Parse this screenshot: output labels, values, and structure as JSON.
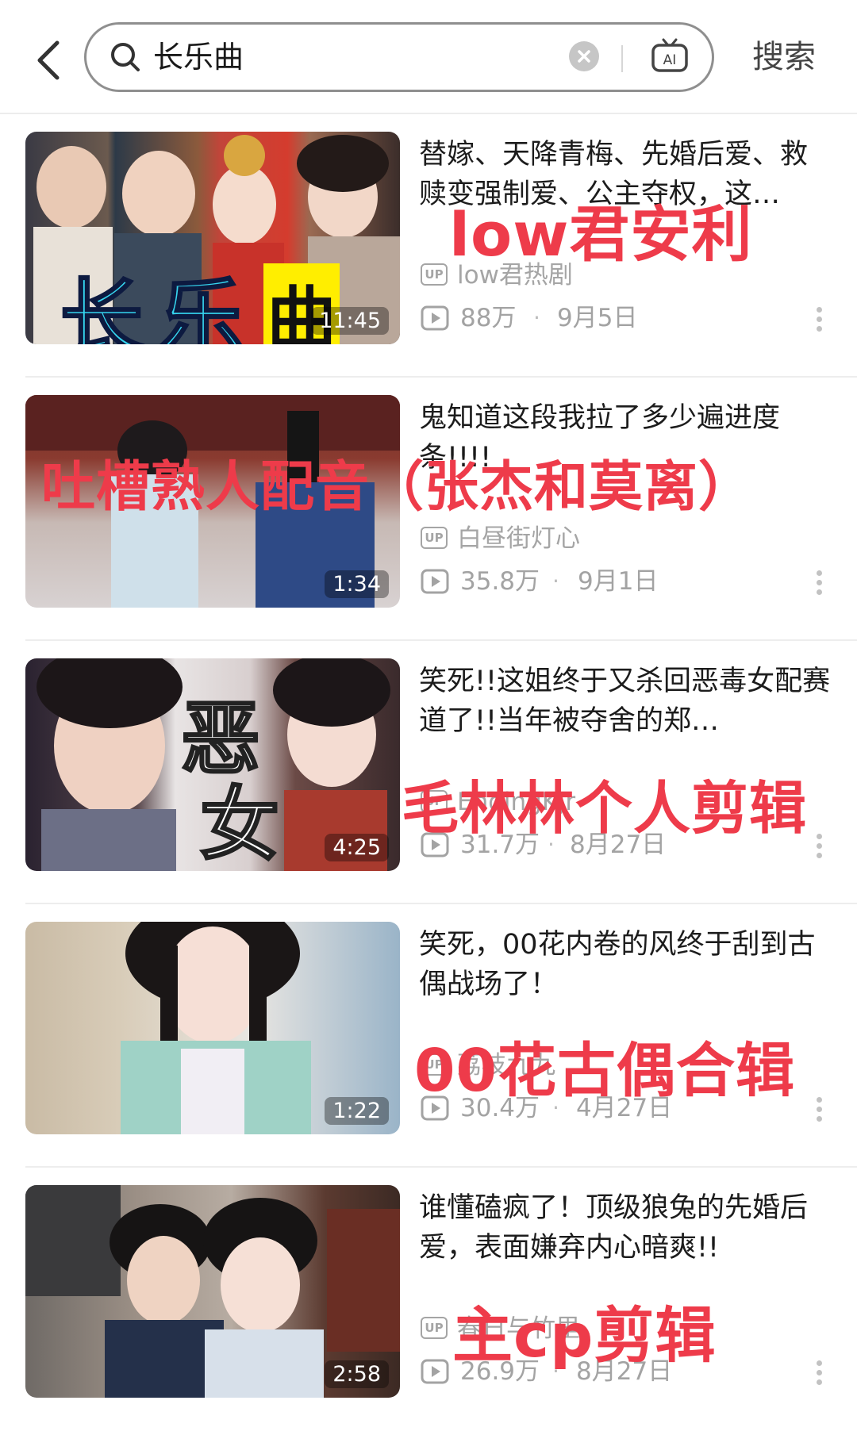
{
  "search": {
    "query": "长乐曲",
    "submit_label": "搜索",
    "ai_label": "AI"
  },
  "results": [
    {
      "title": "替嫁、天降青梅、先婚后爱、救赎变强制爱、公主夺权，这…",
      "uploader": "low君热剧",
      "views": "88万",
      "date": "9月5日",
      "duration": "11:45",
      "overlay_text": "low君安利",
      "thumb_text": [
        "长",
        "乐",
        "曲"
      ]
    },
    {
      "title": "鬼知道这段我拉了多少遍进度条!!!!",
      "uploader": "白昼街灯心",
      "views": "35.8万",
      "date": "9月1日",
      "duration": "1:34",
      "overlay_text": "吐槽熟人配音（张杰和莫离）"
    },
    {
      "title": "笑死!!这姐终于又杀回恶毒女配赛道了!!当年被夺舍的郑…",
      "uploader": "EndingKJr",
      "views": "31.7万",
      "date": "8月27日",
      "duration": "4:25",
      "overlay_text": "毛林林个人剪辑",
      "thumb_text": [
        "恶",
        "女"
      ]
    },
    {
      "title": "笑死，00花内卷的风终于刮到古偶战场了！",
      "uploader": "荔枝九九",
      "views": "30.4万",
      "date": "4月27日",
      "duration": "1:22",
      "overlay_text": "00花古偶合辑"
    },
    {
      "title": "谁懂磕疯了！顶级狼兔的先婚后爱，表面嫌弃内心暗爽!!",
      "uploader": "春日与竹里",
      "views": "26.9万",
      "date": "8月27日",
      "duration": "2:58",
      "overlay_text": "主cp剪辑"
    }
  ],
  "icons": {
    "back": "chevron-left-icon",
    "search": "search-icon",
    "clear": "clear-icon",
    "ai": "ai-tv-icon",
    "play": "play-count-icon",
    "more": "more-vertical-icon"
  },
  "colors": {
    "overlay_red": "#ee3b4a",
    "meta_gray": "#a3a3a3"
  }
}
